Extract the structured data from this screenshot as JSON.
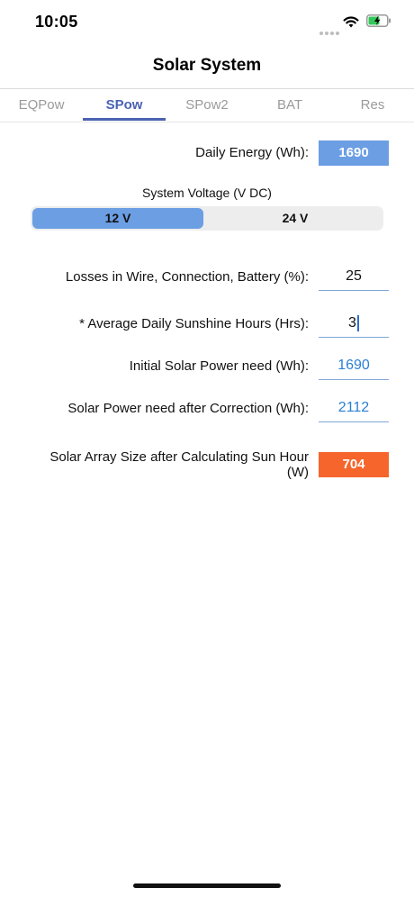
{
  "status": {
    "time": "10:05"
  },
  "nav": {
    "title": "Solar System"
  },
  "tabs": [
    {
      "label": "EQPow"
    },
    {
      "label": "SPow"
    },
    {
      "label": "SPow2"
    },
    {
      "label": "BAT"
    },
    {
      "label": "Res"
    }
  ],
  "active_tab": "SPow",
  "form": {
    "daily_energy_label": "Daily Energy (Wh):",
    "daily_energy_value": "1690",
    "system_voltage_label": "System Voltage (V DC)",
    "voltage_options": [
      "12 V",
      "24 V"
    ],
    "voltage_selected": "12 V",
    "losses_label": "Losses in Wire, Connection, Battery (%):",
    "losses_value": "25",
    "sunshine_label": "* Average Daily Sunshine Hours (Hrs):",
    "sunshine_value": "3",
    "initial_power_label": "Initial Solar Power need (Wh):",
    "initial_power_value": "1690",
    "corrected_power_label": "Solar Power need after Correction (Wh):",
    "corrected_power_value": "2112",
    "array_size_label_line1": "Solar Array Size after Calculating Sun Hour",
    "array_size_label_line2": "(W)",
    "array_size_value": "704"
  },
  "colors": {
    "accent": "#4a62b3",
    "box_blue": "#6b9ee3",
    "box_orange": "#f5652c",
    "field_text_blue": "#2a7fd4"
  }
}
